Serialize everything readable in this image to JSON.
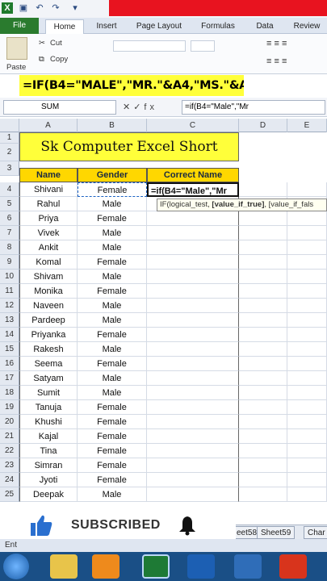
{
  "quick_access": {
    "excel_icon": "X",
    "save_icon": "save-icon",
    "undo_icon": "undo-icon",
    "redo_icon": "redo-icon"
  },
  "ribbon_tabs": [
    "File",
    "Home",
    "Insert",
    "Page Layout",
    "Formulas",
    "Data",
    "Review"
  ],
  "ribbon": {
    "cut": "Cut",
    "copy": "Copy",
    "paste": "Paste"
  },
  "banner": "=IF(B4=\"MALE\",\"MR.\"&A4,\"MS.\"&A4)",
  "formula_bar": {
    "name_box": "SUM",
    "fx_symbols": "✕✓fx",
    "formula": "=if(B4=\"Male\",\"Mr"
  },
  "columns": [
    "A",
    "B",
    "C",
    "D",
    "E"
  ],
  "title": "Sk Computer Excel Short",
  "headers": {
    "name": "Name",
    "gender": "Gender",
    "correct_name": "Correct Name"
  },
  "rows": [
    {
      "row": "4",
      "name": "Shivani",
      "gender": "Female",
      "correct": "=if(B4=\"Male\",\"Mr"
    },
    {
      "row": "5",
      "name": "Rahul",
      "gender": "Male",
      "correct": ""
    },
    {
      "row": "6",
      "name": "Priya",
      "gender": "Female",
      "correct": ""
    },
    {
      "row": "7",
      "name": "Vivek",
      "gender": "Male",
      "correct": ""
    },
    {
      "row": "8",
      "name": "Ankit",
      "gender": "Male",
      "correct": ""
    },
    {
      "row": "9",
      "name": "Komal",
      "gender": "Female",
      "correct": ""
    },
    {
      "row": "10",
      "name": "Shivam",
      "gender": "Male",
      "correct": ""
    },
    {
      "row": "11",
      "name": "Monika",
      "gender": "Female",
      "correct": ""
    },
    {
      "row": "12",
      "name": "Naveen",
      "gender": "Male",
      "correct": ""
    },
    {
      "row": "13",
      "name": "Pardeep",
      "gender": "Male",
      "correct": ""
    },
    {
      "row": "14",
      "name": "Priyanka",
      "gender": "Female",
      "correct": ""
    },
    {
      "row": "15",
      "name": "Rakesh",
      "gender": "Male",
      "correct": ""
    },
    {
      "row": "16",
      "name": "Seema",
      "gender": "Female",
      "correct": ""
    },
    {
      "row": "17",
      "name": "Satyam",
      "gender": "Male",
      "correct": ""
    },
    {
      "row": "18",
      "name": "Sumit",
      "gender": "Male",
      "correct": ""
    },
    {
      "row": "19",
      "name": "Tanuja",
      "gender": "Female",
      "correct": ""
    },
    {
      "row": "20",
      "name": "Khushi",
      "gender": "Female",
      "correct": ""
    },
    {
      "row": "21",
      "name": "Kajal",
      "gender": "Female",
      "correct": ""
    },
    {
      "row": "22",
      "name": "Tina",
      "gender": "Female",
      "correct": ""
    },
    {
      "row": "23",
      "name": "Simran",
      "gender": "Female",
      "correct": ""
    },
    {
      "row": "24",
      "name": "Jyoti",
      "gender": "Female",
      "correct": ""
    },
    {
      "row": "25",
      "name": "Deepak",
      "gender": "Male",
      "correct": ""
    }
  ],
  "row_numbers_top": [
    "1",
    "2",
    "3"
  ],
  "tooltip": {
    "start": "IF(logical_test, ",
    "bold": "[value_if_true]",
    "end": ", [value_if_fals"
  },
  "sheet_tabs": [
    "eet58",
    "Sheet59",
    "Char"
  ],
  "subscribe": {
    "label": "SUBSCRIBED"
  },
  "status_left": "Ent",
  "colors": {
    "title_fill": "#ffff3a",
    "header_fill": "#ffd700",
    "accent_red": "#e8131f",
    "file_tab": "#2a7b2e"
  }
}
